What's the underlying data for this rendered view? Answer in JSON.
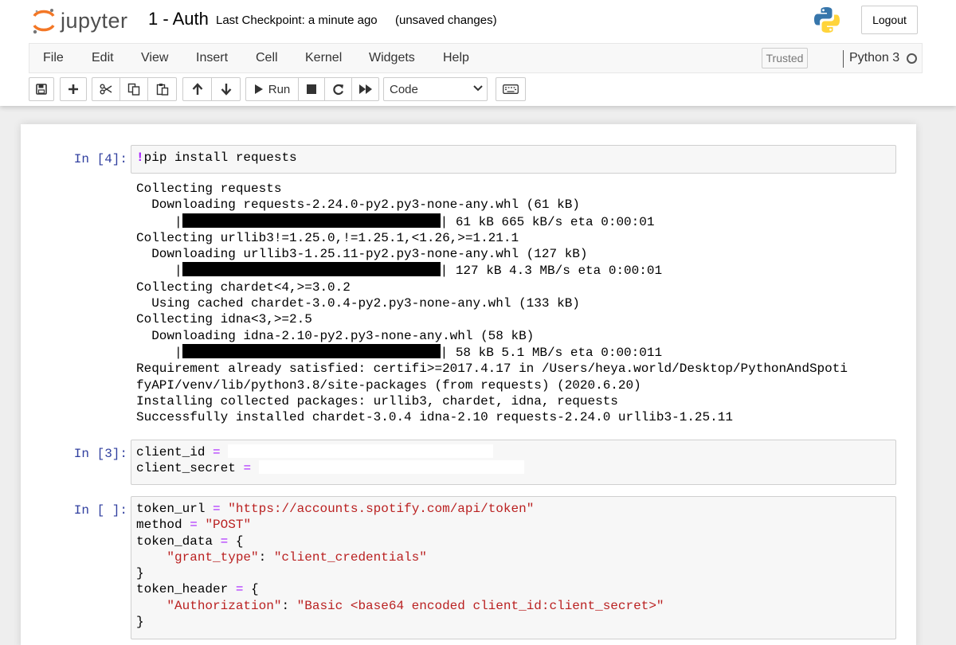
{
  "header": {
    "logo_text": "jupyter",
    "notebook_title": "1 - Auth",
    "checkpoint": "Last Checkpoint: a minute ago",
    "autosave": "(unsaved changes)",
    "logout_label": "Logout"
  },
  "menubar": {
    "items": [
      "File",
      "Edit",
      "View",
      "Insert",
      "Cell",
      "Kernel",
      "Widgets",
      "Help"
    ],
    "trusted_label": "Trusted",
    "kernel_name": "Python 3"
  },
  "toolbar": {
    "run_label": "Run",
    "cell_type": "Code",
    "buttons": [
      "save-icon",
      "plus-icon",
      "cut-icon",
      "copy-icon",
      "paste-icon",
      "arrow-up-icon",
      "arrow-down-icon",
      "run-icon",
      "stop-icon",
      "restart-icon",
      "fast-forward-icon",
      "keyboard-icon"
    ]
  },
  "cells": [
    {
      "prompt": "In [4]:",
      "magic": "!",
      "code": "pip install requests",
      "output": {
        "l1": "Collecting requests",
        "l2": "  Downloading requests-2.24.0-py2.py3-none-any.whl (61 kB)",
        "l3_pre": "     |",
        "l3_post": "| 61 kB 665 kB/s eta 0:00:01",
        "l4": "Collecting urllib3!=1.25.0,!=1.25.1,<1.26,>=1.21.1",
        "l5": "  Downloading urllib3-1.25.11-py2.py3-none-any.whl (127 kB)",
        "l6_pre": "     |",
        "l6_post": "| 127 kB 4.3 MB/s eta 0:00:01",
        "l7": "Collecting chardet<4,>=3.0.2",
        "l8": "  Using cached chardet-3.0.4-py2.py3-none-any.whl (133 kB)",
        "l9": "Collecting idna<3,>=2.5",
        "l10": "  Downloading idna-2.10-py2.py3-none-any.whl (58 kB)",
        "l11_pre": "     |",
        "l11_post": "| 58 kB 5.1 MB/s eta 0:00:011",
        "l12": "Requirement already satisfied: certifi>=2017.4.17 in /Users/heya.world/Desktop/PythonAndSpoti",
        "l13": "fyAPI/venv/lib/python3.8/site-packages (from requests) (2020.6.20)",
        "l14": "Installing collected packages: urllib3, chardet, idna, requests",
        "l15": "Successfully installed chardet-3.0.4 idna-2.10 requests-2.24.0 urllib3-1.25.11"
      }
    },
    {
      "prompt": "In [3]:",
      "line1_name": "client_id",
      "line2_name": "client_secret",
      "op": "="
    },
    {
      "prompt": "In [ ]:",
      "l1_name": "token_url",
      "l1_val": "\"https://accounts.spotify.com/api/token\"",
      "l2_name": "method",
      "l2_val": "\"POST\"",
      "l3_name": "token_data",
      "l3_rest": " {",
      "l4_key": "\"grant_type\"",
      "l4_val": "\"client_credentials\"",
      "l5": "}",
      "l6_name": "token_header",
      "l6_rest": " {",
      "l7_key": "\"Authorization\"",
      "l7_val": "\"Basic <base64 encoded client_id:client_secret>\"",
      "l8": "}",
      "op": "=",
      "colon": ": "
    }
  ],
  "colors": {
    "prompt": "#303f9f",
    "magic": "#aa22ff",
    "string": "#ba2121",
    "logo_orange": "#f37726",
    "python_blue": "#3776ab",
    "python_yellow": "#ffd43b"
  }
}
